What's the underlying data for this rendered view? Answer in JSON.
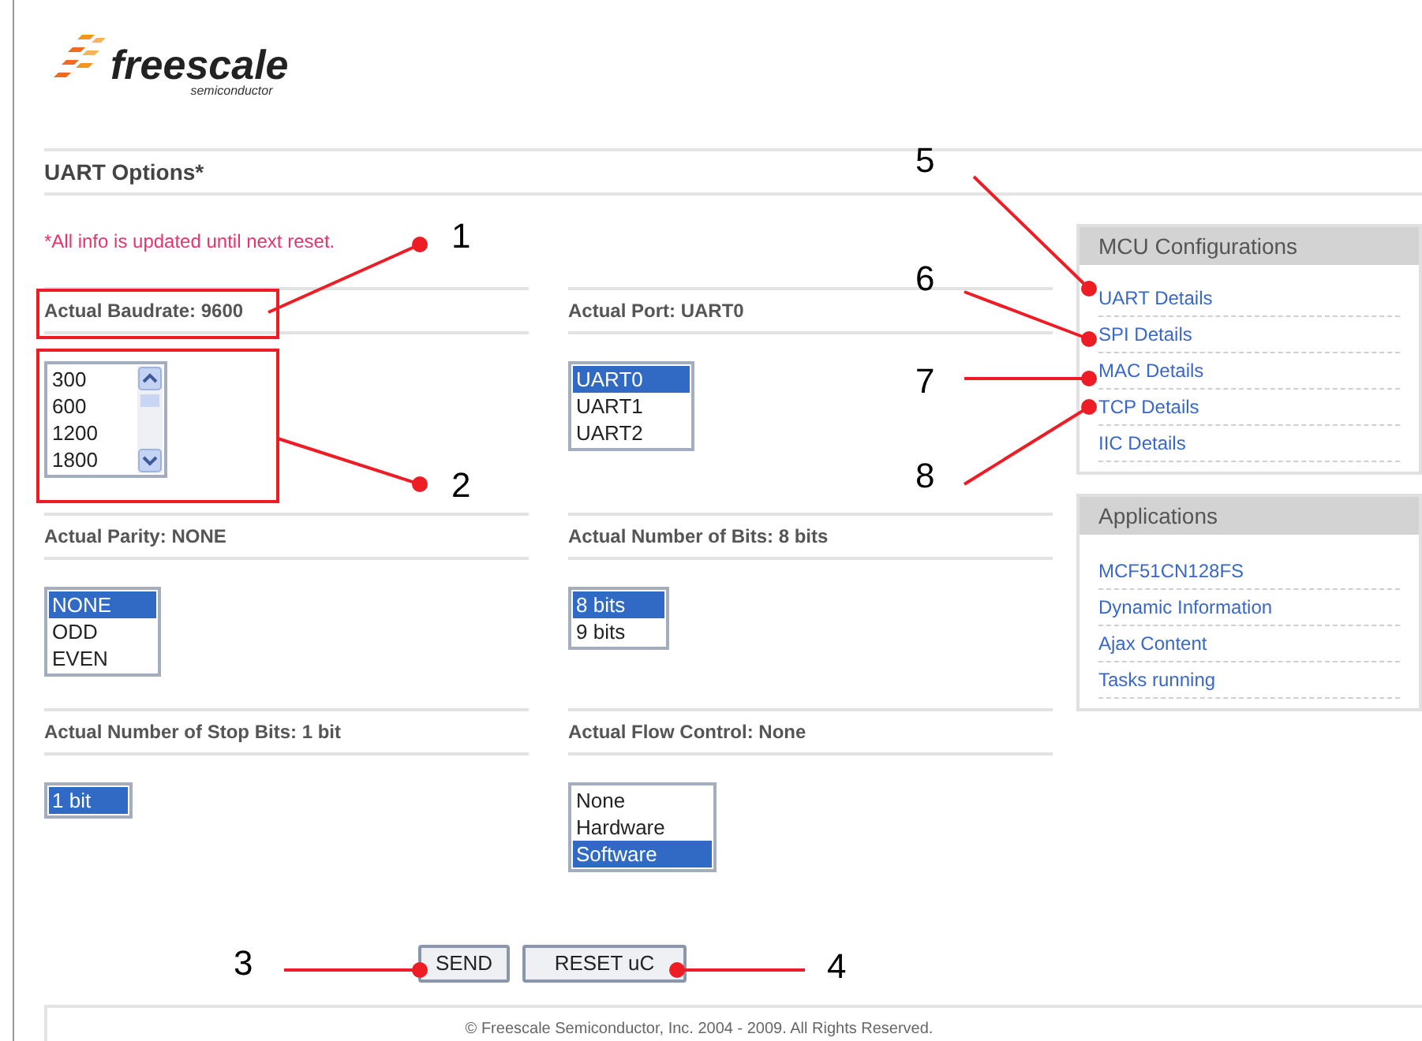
{
  "logo": {
    "name": "freescale",
    "tagline": "semiconductor"
  },
  "heading": "UART Options*",
  "note": "*All info is updated until next reset.",
  "rows": [
    [
      {
        "label": "Actual Baudrate: 9600",
        "kind": "scroll-list",
        "options": [
          {
            "text": "300",
            "selected": false
          },
          {
            "text": "600",
            "selected": false
          },
          {
            "text": "1200",
            "selected": false
          },
          {
            "text": "1800",
            "selected": false
          }
        ]
      },
      {
        "label": "Actual Port: UART0",
        "kind": "list",
        "options": [
          {
            "text": "UART0",
            "selected": true
          },
          {
            "text": "UART1",
            "selected": false
          },
          {
            "text": "UART2",
            "selected": false
          }
        ]
      }
    ],
    [
      {
        "label": "Actual Parity: NONE",
        "kind": "list",
        "options": [
          {
            "text": "NONE",
            "selected": true
          },
          {
            "text": "ODD",
            "selected": false
          },
          {
            "text": "EVEN",
            "selected": false
          }
        ]
      },
      {
        "label": "Actual Number of Bits: 8 bits",
        "kind": "list",
        "options": [
          {
            "text": "8 bits",
            "selected": true
          },
          {
            "text": "9 bits",
            "selected": false
          }
        ]
      }
    ],
    [
      {
        "label": "Actual Number of Stop Bits: 1 bit",
        "kind": "list",
        "options": [
          {
            "text": "1 bit",
            "selected": true
          }
        ]
      },
      {
        "label": "Actual Flow Control: None",
        "kind": "list",
        "options": [
          {
            "text": "None",
            "selected": false
          },
          {
            "text": "Hardware",
            "selected": false
          },
          {
            "text": "Software",
            "selected": true
          }
        ]
      }
    ]
  ],
  "buttons": [
    "SEND",
    "RESET uC"
  ],
  "footer": "© Freescale Semiconductor, Inc. 2004 - 2009. All Rights Reserved.",
  "sidebar": [
    {
      "title": "MCU Configurations",
      "links": [
        "UART Details",
        "SPI Details",
        "MAC Details",
        "TCP Details",
        "IIC Details"
      ]
    },
    {
      "title": "Applications",
      "links": [
        "MCF51CN128FS",
        "Dynamic Information",
        "Ajax Content",
        "Tasks running"
      ]
    }
  ],
  "callouts": [
    {
      "label": "1"
    },
    {
      "label": "2"
    },
    {
      "label": "3"
    },
    {
      "label": "4"
    },
    {
      "label": "5"
    },
    {
      "label": "6"
    },
    {
      "label": "7"
    },
    {
      "label": "8"
    }
  ]
}
